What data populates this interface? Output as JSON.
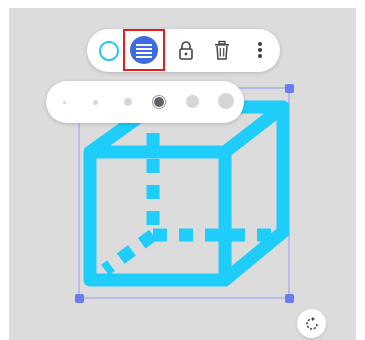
{
  "toolbar": {
    "items": [
      {
        "icon": "circle-outline-icon",
        "color": "#29c5f6"
      },
      {
        "icon": "stroke-style-icon",
        "color": "#3d6be0",
        "selected": true,
        "highlight": "#e1201d"
      },
      {
        "icon": "lock-icon"
      },
      {
        "icon": "trash-icon"
      },
      {
        "icon": "more-vertical-icon"
      }
    ]
  },
  "stroke_picker": {
    "levels": 6,
    "selected_index": 3
  },
  "shape": {
    "type": "cube",
    "stroke_color": "#1fcdfb",
    "selection_color": "#6a7df0"
  },
  "rotate": {
    "icon": "rotate-icon"
  }
}
